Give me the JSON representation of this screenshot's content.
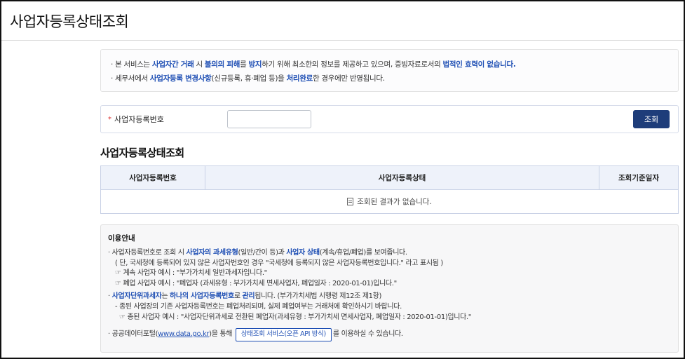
{
  "header": {
    "title": "사업자등록상태조회"
  },
  "notice": {
    "line1": [
      {
        "t": "· 본 서비스는 ",
        "b": false
      },
      {
        "t": "사업자간 거래",
        "b": true
      },
      {
        "t": " 시 ",
        "b": false
      },
      {
        "t": "불의의 피해",
        "b": true
      },
      {
        "t": "를 ",
        "b": false
      },
      {
        "t": "방지",
        "b": true
      },
      {
        "t": "하기 위해 최소한의 정보를 제공하고 있으며, 증빙자료로서의 ",
        "b": false
      },
      {
        "t": "법적인 효력이 없습니다.",
        "b": true
      }
    ],
    "line2": [
      {
        "t": "· 세무서에서 ",
        "b": false
      },
      {
        "t": "사업자등록 변경사항",
        "b": true
      },
      {
        "t": "(신규등록, 휴·폐업 등)을 ",
        "b": false
      },
      {
        "t": "처리완료",
        "b": true
      },
      {
        "t": "한 경우에만 반영됩니다.",
        "b": false
      }
    ]
  },
  "search": {
    "required_mark": "*",
    "label": "사업자등록번호",
    "value": "",
    "button": "조회"
  },
  "results": {
    "title": "사업자등록상태조회",
    "columns": [
      "사업자등록번호",
      "사업자등록상태",
      "조회기준일자"
    ],
    "empty": "조회된 결과가 없습니다."
  },
  "guide": {
    "title": "이용안내",
    "l1": [
      {
        "t": "· 사업자등록번호로 조회 시 ",
        "b": false
      },
      {
        "t": "사업자의 과세유형",
        "b": true
      },
      {
        "t": "(일반/간이 등)과 ",
        "b": false
      },
      {
        "t": "사업자 상태",
        "b": true
      },
      {
        "t": "(계속/휴업/폐업)를 보여줍니다.",
        "b": false
      }
    ],
    "l2": "( 단, 국세청에 등록되어 있지 않은 사업자번호인 경우 \"국세청에 등록되지 않은 사업자등록번호입니다.\" 라고 표시됨 )",
    "l3": "☞ 계속 사업자 예시 : \"부가가치세 일반과세자입니다.\"",
    "l4": "☞ 폐업 사업자 예시 : \"폐업자 (과세유형 : 부가가치세 면세사업자, 폐업일자 : 2020-01-01)입니다.\"",
    "l5": [
      {
        "t": "· ",
        "b": false
      },
      {
        "t": "사업자단위과세자",
        "b": true
      },
      {
        "t": "는 ",
        "b": false
      },
      {
        "t": "하나의 사업자등록번호",
        "b": true
      },
      {
        "t": "로 ",
        "b": false
      },
      {
        "t": "관리",
        "b": true
      },
      {
        "t": "됩니다. (부가가치세법 시행령 제12조 제1항)",
        "b": false
      }
    ],
    "l6": "- 종된 사업장의 기존 사업자등록번호는 폐업처리되며, 실제 폐업여부는 거래처에 확인하시기 바랍니다.",
    "l7": "☞ 종된 사업자 예시 : \"사업자단위과세로 전환된 폐업자(과세유형 : 부가가치세 면세사업자, 폐업일자 : 2020-01-01)입니다.\"",
    "l8_pre": "· 공공데이터포털(",
    "l8_link": "www.data.go.kr",
    "l8_mid": ")을 통해 ",
    "l8_button": "상태조회 서비스(오픈 API 방식)",
    "l8_post": "를 이용하실 수 있습니다."
  },
  "colors": {
    "accent": "#1f4fb4",
    "button": "#1e3d7a",
    "header_row": "#eef2fa"
  }
}
